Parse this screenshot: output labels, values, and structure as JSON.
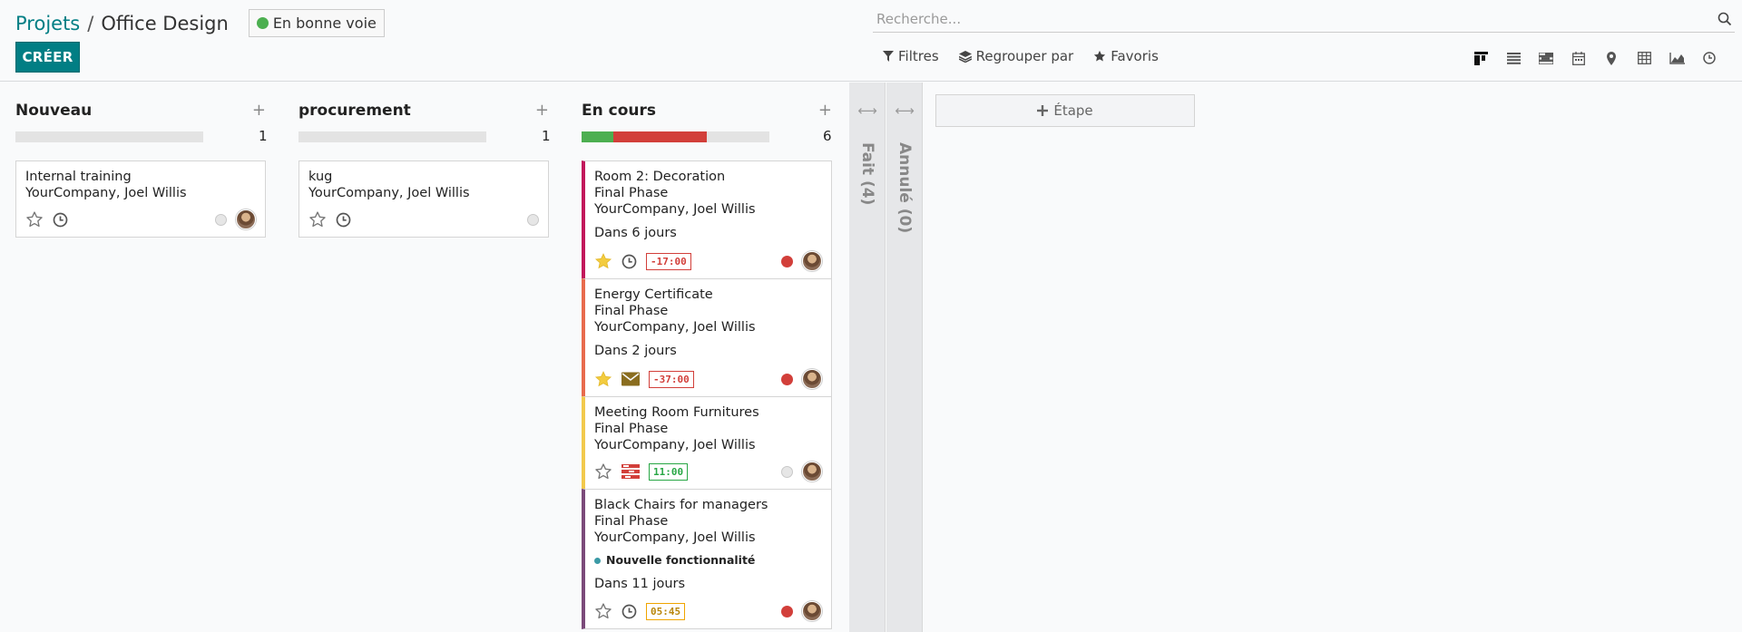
{
  "breadcrumb": {
    "parent": "Projets",
    "sep": "/",
    "current": "Office Design"
  },
  "status": {
    "label": "En bonne voie",
    "color": "#4caf50"
  },
  "create_label": "CRÉER",
  "search": {
    "placeholder": "Recherche..."
  },
  "filters": {
    "filters": "Filtres",
    "group_by": "Regrouper par",
    "favorites": "Favoris"
  },
  "views": [
    "kanban-icon",
    "list-icon",
    "gantt-icon",
    "calendar-icon",
    "map-icon",
    "pivot-icon",
    "graph-icon",
    "activity-icon"
  ],
  "columns": [
    {
      "title": "Nouveau",
      "count": "1",
      "progress": [],
      "cards": [
        {
          "name": "Internal training",
          "company": "YourCompany, Joel Willis",
          "starred": false,
          "activity": "clock",
          "kanban": "grey"
        }
      ]
    },
    {
      "title": "procurement",
      "count": "1",
      "progress": [],
      "cards": [
        {
          "name": "kug",
          "company": "YourCompany, Joel Willis",
          "starred": false,
          "activity": "clock",
          "kanban": "grey"
        }
      ]
    },
    {
      "title": "En cours",
      "count": "6",
      "progress": [
        {
          "fraction": 0.167,
          "color": "#4caf50"
        },
        {
          "fraction": 0.5,
          "color": "#d23f3a"
        }
      ],
      "cards": [
        {
          "name": "Room 2: Decoration",
          "phase": "Final Phase",
          "company": "YourCompany, Joel Willis",
          "deadline": "Dans 6 jours",
          "starred": true,
          "activity": "clock",
          "timer": "-17:00",
          "timer_color": "#d23f3a",
          "kanban": "red",
          "accent": "#c2185b"
        },
        {
          "name": "Energy Certificate",
          "phase": "Final Phase",
          "company": "YourCompany, Joel Willis",
          "deadline": "Dans 2 jours",
          "starred": true,
          "activity": "email",
          "timer": "-37:00",
          "timer_color": "#d23f3a",
          "kanban": "red",
          "accent": "#e86b4d"
        },
        {
          "name": "Meeting Room Furnitures",
          "phase": "Final Phase",
          "company": "YourCompany, Joel Willis",
          "starred": false,
          "activity": "tasks",
          "timer": "11:00",
          "timer_color": "#28a745",
          "kanban": "grey",
          "accent": "#f2c94c"
        },
        {
          "name": "Black Chairs for managers",
          "phase": "Final Phase",
          "company": "YourCompany, Joel Willis",
          "tag": "Nouvelle fonctionnalité",
          "deadline": "Dans 11 jours",
          "starred": false,
          "activity": "clock",
          "timer": "05:45",
          "timer_color": "#f0a500",
          "kanban": "red",
          "accent": "#7b4a7a"
        }
      ]
    }
  ],
  "folded": [
    {
      "title": "Fait (4)"
    },
    {
      "title": "Annulé (0)"
    }
  ],
  "add_stage": "Étape"
}
